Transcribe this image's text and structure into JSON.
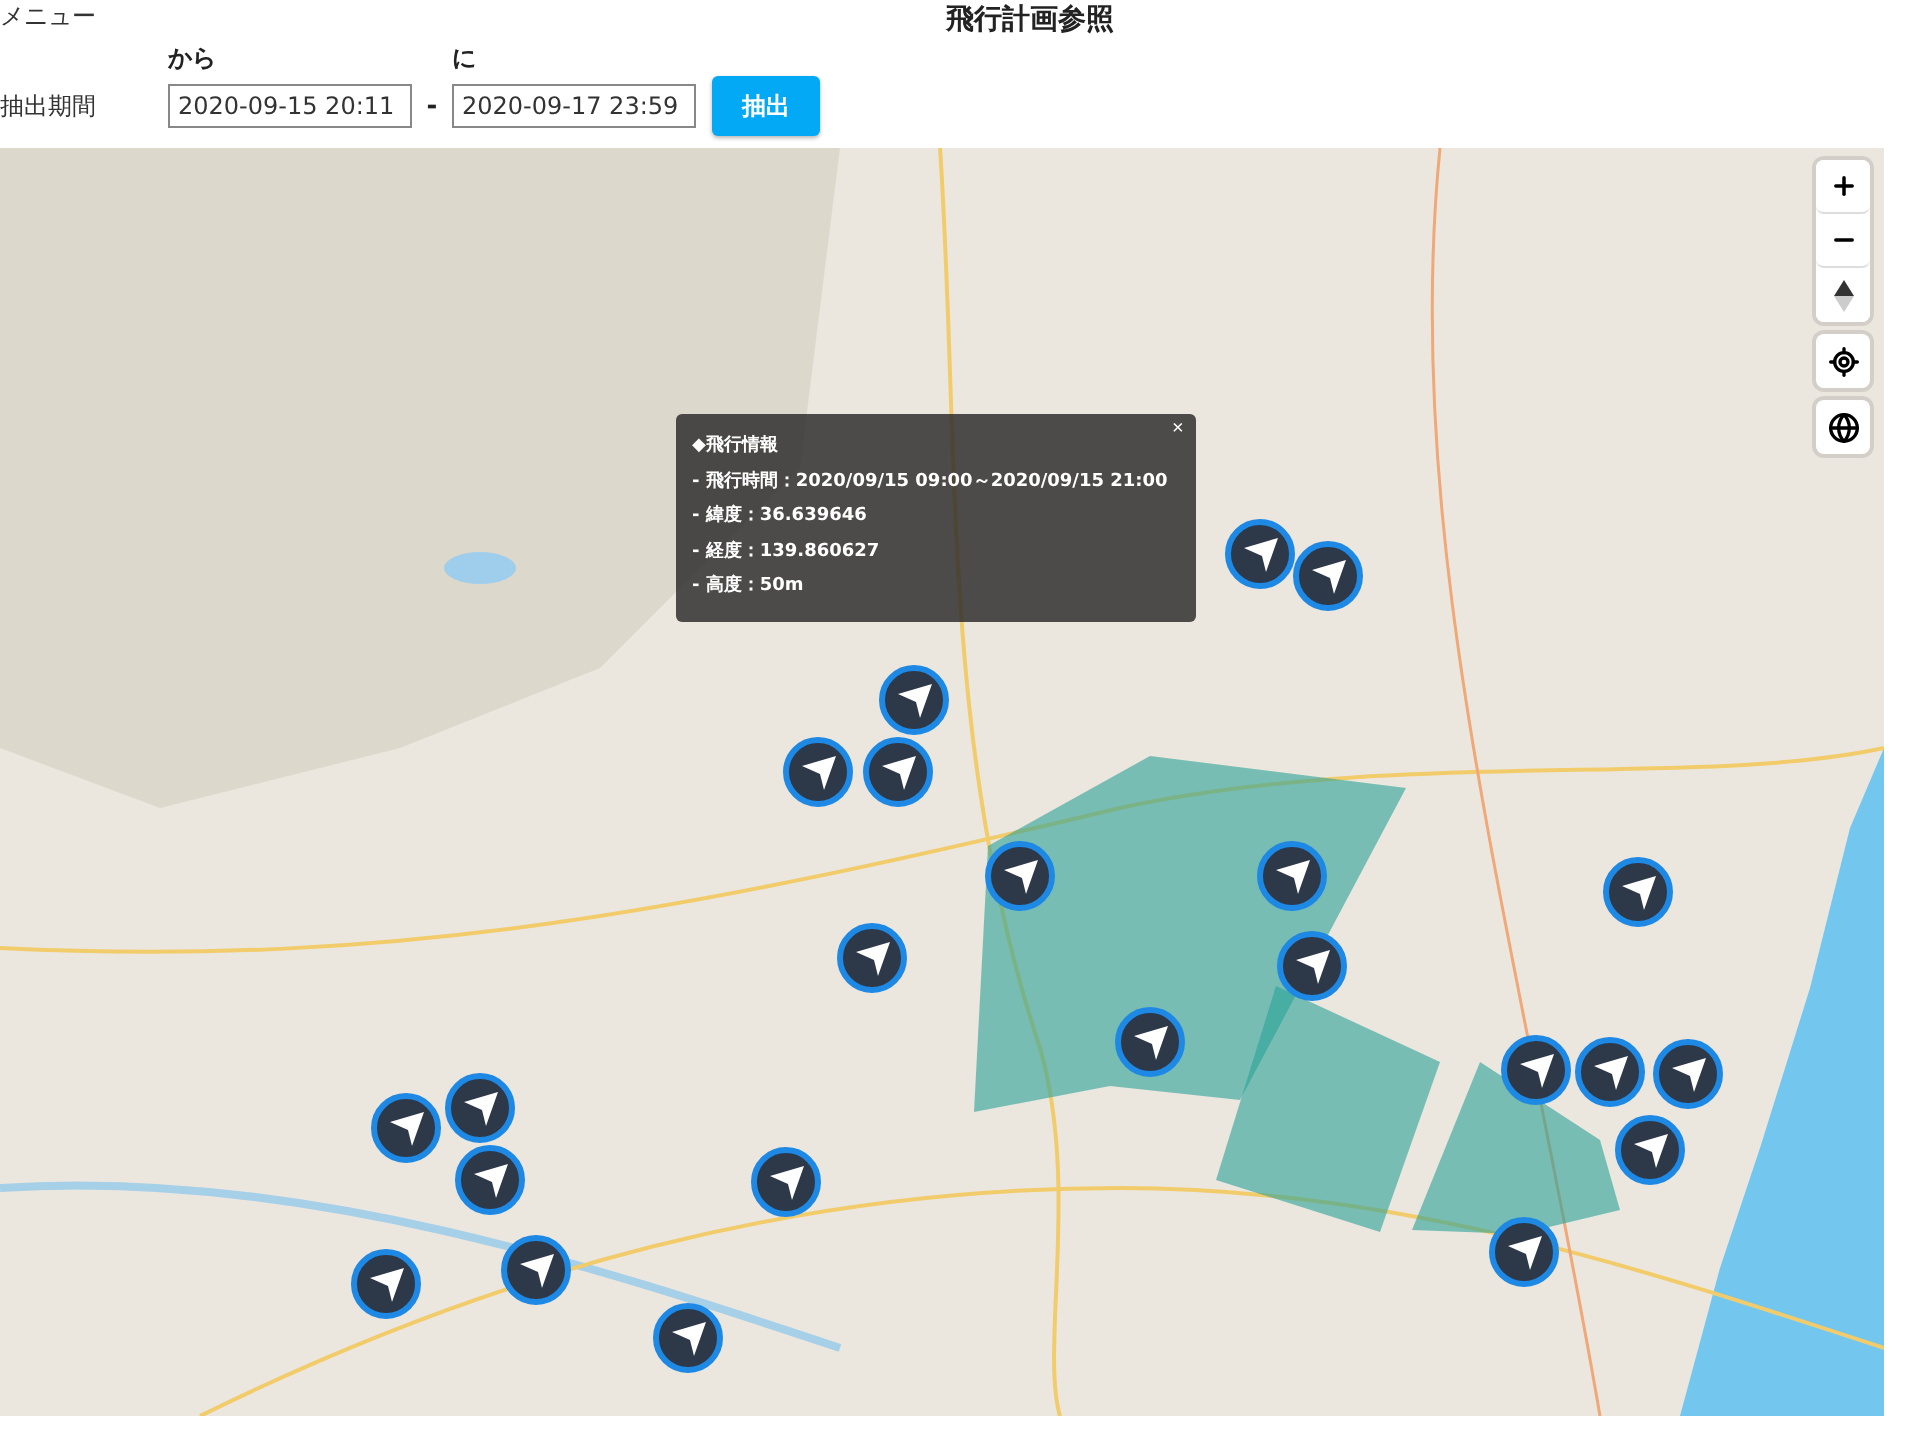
{
  "menu": "メニュー",
  "title": "飛行計画参照",
  "period": {
    "label": "抽出期間",
    "from": {
      "label": "から",
      "value": "2020-09-15 20:11"
    },
    "separator": "-",
    "to": {
      "label": "に",
      "value": "2020-09-17 23:59"
    },
    "button": "抽出"
  },
  "popup": {
    "title": "◆飛行情報",
    "close": "×",
    "lines": [
      "- 飛行時間：2020/09/15 09:00～2020/09/15 21:00",
      "- 緯度：36.639646",
      "- 経度：139.860627",
      "- 高度：50m"
    ]
  }
}
